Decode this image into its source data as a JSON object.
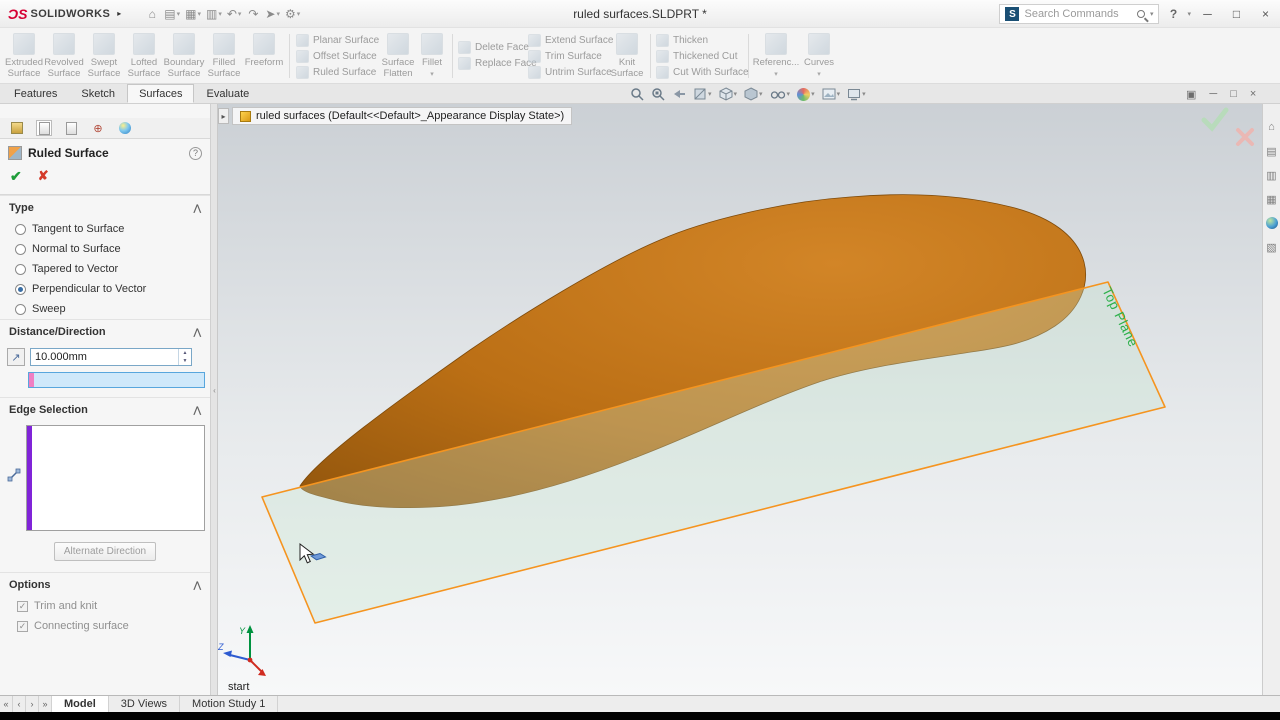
{
  "titlebar": {
    "logo": "SOLIDWORKS",
    "title": "ruled surfaces.SLDPRT *",
    "search_placeholder": "Search Commands",
    "help": "?"
  },
  "ribbon": {
    "big": [
      "Extruded Surface",
      "Revolved Surface",
      "Swept Surface",
      "Lofted Surface",
      "Boundary Surface",
      "Filled Surface",
      "Freeform"
    ],
    "planar": [
      "Planar Surface",
      "Offset Surface",
      "Ruled Surface"
    ],
    "flatten": "Surface Flatten",
    "fillet": "Fillet",
    "faces": [
      "Delete Face",
      "Replace Face"
    ],
    "trims": [
      "Extend Surface",
      "Trim Surface",
      "Untrim Surface"
    ],
    "knit": "Knit Surface",
    "thicken": [
      "Thicken",
      "Thickened Cut",
      "Cut With Surface"
    ],
    "reference": "Referenc...",
    "curves": "Curves"
  },
  "command_tabs": [
    "Features",
    "Sketch",
    "Surfaces",
    "Evaluate"
  ],
  "pm": {
    "title": "Ruled Surface",
    "type_label": "Type",
    "type_options": [
      "Tangent to Surface",
      "Normal to Surface",
      "Tapered to Vector",
      "Perpendicular to Vector",
      "Sweep"
    ],
    "distance_label": "Distance/Direction",
    "distance_value": "10.000mm",
    "edge_label": "Edge Selection",
    "alternate_button": "Alternate Direction",
    "options_label": "Options",
    "check1": "Trim and knit",
    "check2": "Connecting surface"
  },
  "viewport": {
    "tree_item": "ruled surfaces  (Default<<Default>_Appearance Display State>)",
    "plane_label": "Top Plane",
    "start_label": "start"
  },
  "bottom": {
    "tabs": [
      "Model",
      "3D Views",
      "Motion Study 1"
    ]
  },
  "colors": {
    "surface_orange": "#bb6f15",
    "plane_border": "#f5941f",
    "plane_label_green": "#2db04b",
    "selection_blue": "#cfe8fa",
    "edge_stripe_purple": "#8024d8"
  }
}
